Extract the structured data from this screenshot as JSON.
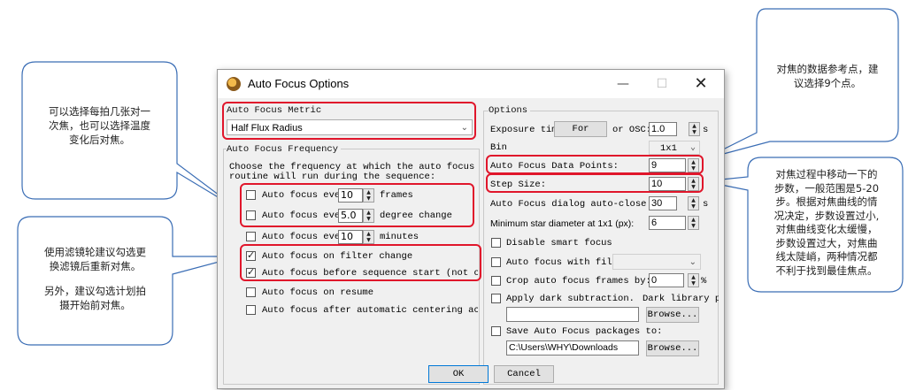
{
  "window": {
    "title": "Auto Focus Options",
    "min_icon": "minimize-icon",
    "max_icon": "maximize-icon",
    "close_icon": "close-icon"
  },
  "left": {
    "metric_label": "Auto Focus Metric",
    "metric_value": "Half Flux Radius",
    "frequency_label": "Auto Focus Frequency",
    "frequency_desc_line1": "Choose the frequency at which the auto focus",
    "frequency_desc_line2": "routine will run during the sequence:",
    "every_frames": {
      "label": "Auto focus ever",
      "value": "10",
      "unit": "frames",
      "checked": false
    },
    "every_degree": {
      "label": "Auto focus ever",
      "value": "5.0",
      "unit": "degree change",
      "checked": false
    },
    "every_minutes": {
      "label": "Auto focus ever",
      "value": "10",
      "unit": "minutes",
      "checked": false
    },
    "on_filter_change": {
      "label": "Auto focus on filter change",
      "checked": true
    },
    "before_sequence": {
      "label": "Auto focus before sequence start (not on r",
      "checked": true
    },
    "on_resume": {
      "label": "Auto focus on resume",
      "checked": false
    },
    "after_centering": {
      "label": "Auto focus after automatic centering actic",
      "checked": false
    }
  },
  "right": {
    "options_label": "Options",
    "exposure_label": "Exposure time",
    "exposure_button": "For",
    "osc_label": "or OSC:",
    "exposure_value": "1.0",
    "exposure_unit": "s",
    "bin_label": "Bin",
    "bin_value": "1x1",
    "data_points_label": "Auto Focus Data Points:",
    "data_points_value": "9",
    "step_size_label": "Step Size:",
    "step_size_value": "10",
    "dialog_close_label": "Auto Focus dialog auto-close d",
    "dialog_close_value": "30",
    "dialog_close_unit": "s",
    "min_star_label": "Minimum star diameter at 1x1 (px):",
    "min_star_value": "6",
    "disable_smart": {
      "label": "Disable smart focus",
      "checked": false
    },
    "with_filter": {
      "label": "Auto focus with filt",
      "checked": false
    },
    "crop": {
      "label": "Crop auto focus frames by:",
      "value": "0",
      "unit": "%",
      "checked": false
    },
    "dark_sub": {
      "label": "Apply dark subtraction.",
      "library_label": "Dark library pa",
      "checked": false
    },
    "browse_label": "Browse...",
    "save_packages": {
      "label": "Save Auto Focus packages to:",
      "checked": false
    },
    "save_path": "C:\\Users\\WHY\\Downloads",
    "browse2_label": "Browse..."
  },
  "footer": {
    "ok_label": "OK",
    "cancel_label": "Cancel"
  },
  "annotations": {
    "top_left": [
      "可以选择每拍几张对一",
      "次焦，也可以选择温度",
      "变化后对焦。"
    ],
    "bottom_left": [
      "使用滤镜轮建议勾选更",
      "换滤镜后重新对焦。",
      "",
      "另外，建议勾选计划拍",
      "摄开始前对焦。"
    ],
    "top_right": [
      "对焦的数据参考点，建",
      "议选择9个点。"
    ],
    "middle_right": [
      "对焦过程中移动一下的",
      "步数，一般范围是5-20",
      "步。根据对焦曲线的情",
      "况决定，步数设置过小,",
      "对焦曲线变化太缓慢，",
      "步数设置过大，对焦曲",
      "线太陡峭，两种情况都",
      "不利于找到最佳焦点。"
    ]
  },
  "colors": {
    "highlight": "#e0162b",
    "callout_border": "#3a6db5"
  }
}
